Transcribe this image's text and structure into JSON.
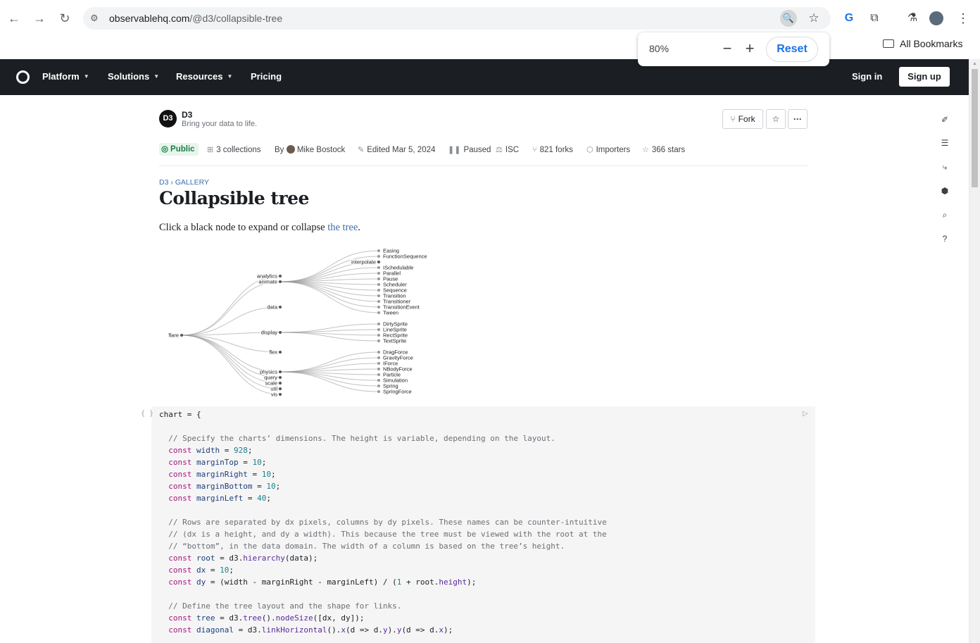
{
  "browser": {
    "url_host": "observablehq.com",
    "url_path": "/@d3/collapsible-tree",
    "bookmarks_label": "All Bookmarks",
    "zoom_popup": {
      "percent": "80%",
      "minus": "−",
      "plus": "+",
      "reset": "Reset"
    }
  },
  "header": {
    "nav": [
      {
        "label": "Platform",
        "has_caret": true
      },
      {
        "label": "Solutions",
        "has_caret": true
      },
      {
        "label": "Resources",
        "has_caret": true
      },
      {
        "label": "Pricing",
        "has_caret": false
      }
    ],
    "sign_in": "Sign in",
    "sign_up": "Sign up"
  },
  "notebook": {
    "author": "D3",
    "author_tagline": "Bring your data to life.",
    "fork_label": "Fork",
    "meta": {
      "visibility": "Public",
      "collections": "3 collections",
      "by_prefix": "By",
      "author_name": "Mike Bostock",
      "edited": "Edited Mar 5, 2024",
      "status": "Paused",
      "license": "ISC",
      "forks": "821 forks",
      "importers": "Importers",
      "stars": "366 stars"
    },
    "breadcrumb": "D3 › GALLERY",
    "title": "Collapsible tree",
    "intro_before": "Click a black node to expand or collapse ",
    "intro_link": "the tree",
    "intro_after": "."
  },
  "tree": {
    "root": "flare",
    "level1": [
      "analytics",
      "animate",
      "data",
      "display",
      "flex",
      "physics",
      "query",
      "scale",
      "util",
      "vis"
    ],
    "animate_children": [
      "Easing",
      "FunctionSequence",
      "interpolate",
      "ISchedulable",
      "Parallel",
      "Pause",
      "Scheduler",
      "Sequence",
      "Transition",
      "Transitioner",
      "TransitionEvent",
      "Tween"
    ],
    "display_children": [
      "DirtySprite",
      "LineSprite",
      "RectSprite",
      "TextSprite"
    ],
    "physics_children": [
      "DragForce",
      "GravityForce",
      "IForce",
      "NBodyForce",
      "Particle",
      "Simulation",
      "Spring",
      "SpringForce"
    ]
  },
  "code_cell": {
    "gutter": "{ }",
    "lines": [
      "chart = {",
      "",
      "  // Specify the charts’ dimensions. The height is variable, depending on the layout.",
      "  const width = 928;",
      "  const marginTop = 10;",
      "  const marginRight = 10;",
      "  const marginBottom = 10;",
      "  const marginLeft = 40;",
      "",
      "  // Rows are separated by dx pixels, columns by dy pixels. These names can be counter-intuitive",
      "  // (dx is a height, and dy a width). This because the tree must be viewed with the root at the",
      "  // “bottom”, in the data domain. The width of a column is based on the tree’s height.",
      "  const root = d3.hierarchy(data);",
      "  const dx = 10;",
      "  const dy = (width - marginRight - marginLeft) / (1 + root.height);",
      "",
      "  // Define the tree layout and the shape for links.",
      "  const tree = d3.tree().nodeSize([dx, dy]);",
      "  const diagonal = d3.linkHorizontal().x(d => d.y).y(d => d.x);"
    ]
  },
  "colors": {
    "header_bg": "#1b1e23",
    "link_blue": "#3b6dad",
    "public_green": "#1a7f45",
    "code_bg": "#f5f5f5",
    "chrome_blue": "#1a73e8"
  }
}
